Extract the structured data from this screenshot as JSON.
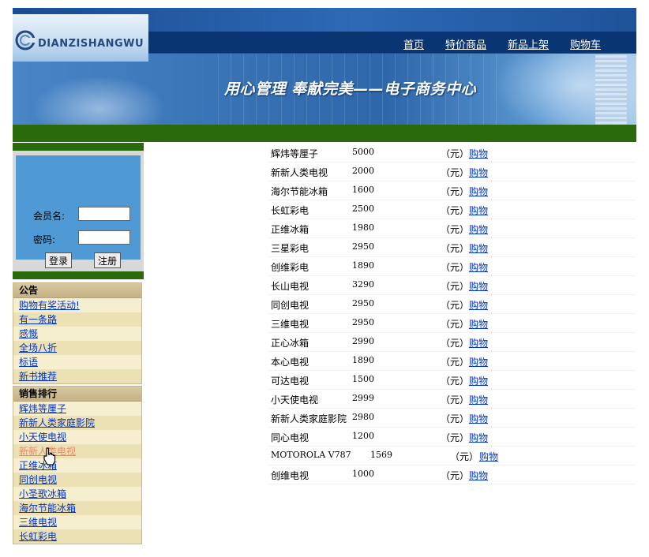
{
  "header": {
    "logo_text": "DIANZISHANGWU",
    "nav": [
      "首页",
      "特价商品",
      "新品上架",
      "购物车"
    ],
    "slogan": "用心管理 奉献完美——电子商务中心"
  },
  "login": {
    "member_label": "会员名:",
    "password_label": "密码:",
    "member_value": "",
    "password_value": "",
    "login_button": "登录",
    "register_button": "注册"
  },
  "notice": {
    "title": "公告",
    "items": [
      "购物有奖活动!",
      "有一条路",
      "感慨",
      "全场八折",
      "标语",
      "新书推荐"
    ]
  },
  "ranking": {
    "title": "销售排行",
    "items": [
      "辉炜等厘子",
      "新新人类家庭影院",
      "小天使电视",
      "新新人类电视",
      "正维冰箱",
      "同创电视",
      "小圣歌冰箱",
      "海尔节能冰箱",
      "三维电视",
      "长虹彩电"
    ]
  },
  "products": {
    "unit": "（元）",
    "buy_label": "购物",
    "items": [
      {
        "name": "辉炜等厘子",
        "price": "5000"
      },
      {
        "name": "新新人类电视",
        "price": "2000"
      },
      {
        "name": "海尔节能冰箱",
        "price": "1600"
      },
      {
        "name": "长虹彩电",
        "price": "2500"
      },
      {
        "name": "正维冰箱",
        "price": "1980"
      },
      {
        "name": "三星彩电",
        "price": "2950"
      },
      {
        "name": "创维彩电",
        "price": "1890"
      },
      {
        "name": "长山电视",
        "price": "3290"
      },
      {
        "name": "同创电视",
        "price": "2950"
      },
      {
        "name": "三维电视",
        "price": "2950"
      },
      {
        "name": "正心冰箱",
        "price": "2990"
      },
      {
        "name": "本心电视",
        "price": "1890"
      },
      {
        "name": "可达电视",
        "price": "1500"
      },
      {
        "name": "小天使电视",
        "price": "2999"
      },
      {
        "name": "新新人类家庭影院",
        "price": "2980"
      },
      {
        "name": "同心电视",
        "price": "1200"
      },
      {
        "name": "MOTOROLA V787",
        "price": "1569"
      },
      {
        "name": "创维电视",
        "price": "1000"
      }
    ]
  },
  "colors": {
    "green_bar": "#2b6a0c",
    "link": "#0033cc",
    "panel_blue": "#4f9ad4",
    "side_bg": "#f4ecc4"
  }
}
